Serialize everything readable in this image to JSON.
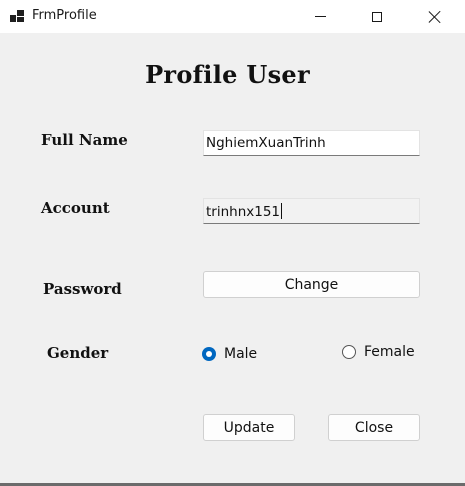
{
  "window": {
    "title": "FrmProfile",
    "icons": {
      "app": "app-form-icon",
      "minimize": "minimize-icon",
      "maximize": "maximize-icon",
      "close": "close-icon"
    }
  },
  "form": {
    "heading": "Profile User",
    "full_name": {
      "label": "Full Name",
      "value": "NghiemXuanTrinh"
    },
    "account": {
      "label": "Account",
      "value": "trinhnx151"
    },
    "password": {
      "label": "Password",
      "button": "Change"
    },
    "gender": {
      "label": "Gender",
      "options": [
        {
          "label": "Male",
          "selected": true
        },
        {
          "label": "Female",
          "selected": false
        }
      ]
    },
    "buttons": {
      "update": "Update",
      "close": "Close"
    }
  },
  "colors": {
    "accent": "#0067c0",
    "background": "#f0f0f0",
    "titlebar": "#ffffff"
  }
}
